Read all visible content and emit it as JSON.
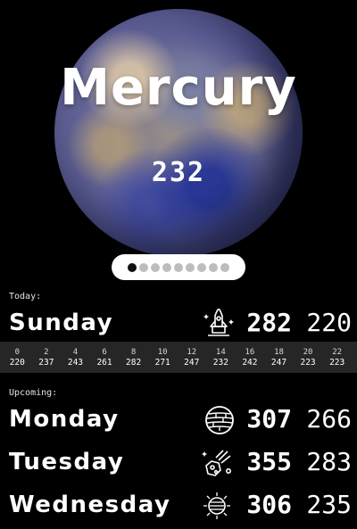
{
  "planet": {
    "name": "Mercury",
    "value": "232"
  },
  "pager": {
    "count": 9,
    "active_index": 0
  },
  "today": {
    "label": "Today:",
    "day": "Sunday",
    "icon": "rocket-icon",
    "high": "282",
    "low": "220",
    "hourly": [
      {
        "time": "0",
        "value": "220"
      },
      {
        "time": "2",
        "value": "237"
      },
      {
        "time": "4",
        "value": "243"
      },
      {
        "time": "6",
        "value": "261"
      },
      {
        "time": "8",
        "value": "282"
      },
      {
        "time": "10",
        "value": "271"
      },
      {
        "time": "12",
        "value": "247"
      },
      {
        "time": "14",
        "value": "232"
      },
      {
        "time": "16",
        "value": "242"
      },
      {
        "time": "18",
        "value": "247"
      },
      {
        "time": "20",
        "value": "223"
      },
      {
        "time": "22",
        "value": "223"
      }
    ]
  },
  "upcoming": {
    "label": "Upcoming:",
    "days": [
      {
        "day": "Monday",
        "icon": "planet-surface-icon",
        "high": "307",
        "low": "266"
      },
      {
        "day": "Tuesday",
        "icon": "meteor-icon",
        "high": "355",
        "low": "283"
      },
      {
        "day": "Wednesday",
        "icon": "sun-icon",
        "high": "306",
        "low": "235"
      }
    ]
  }
}
